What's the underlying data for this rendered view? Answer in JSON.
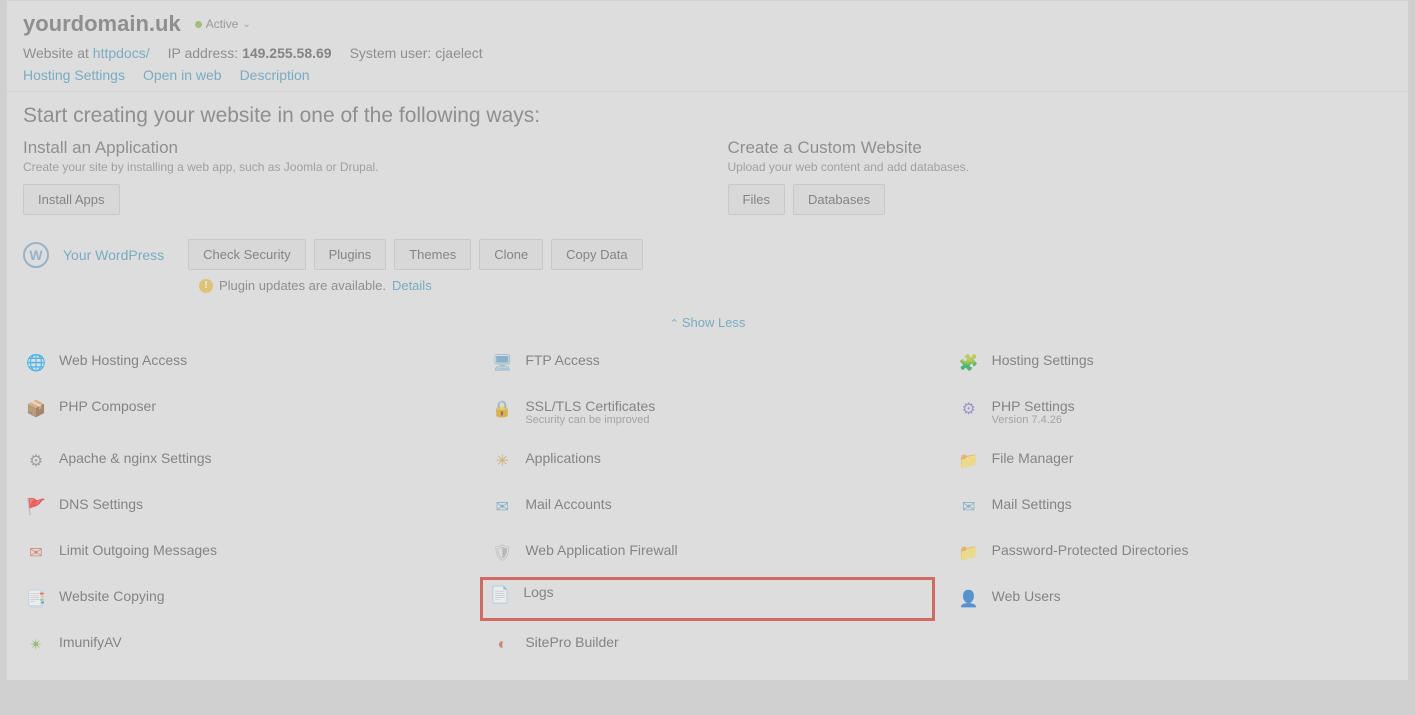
{
  "header": {
    "domain": "yourdomain.uk",
    "status": "Active",
    "website_at_label": "Website at",
    "website_at_link": "httpdocs/",
    "ip_label": "IP address:",
    "ip_value": "149.255.58.69",
    "sysuser_label": "System user:",
    "sysuser_value": "cjaelect",
    "links": {
      "hosting_settings": "Hosting Settings",
      "open_in_web": "Open in web",
      "description": "Description"
    }
  },
  "create": {
    "title": "Start creating your website in one of the following ways:",
    "install": {
      "heading": "Install an Application",
      "desc": "Create your site by installing a web app, such as Joomla or Drupal.",
      "btn": "Install Apps"
    },
    "custom": {
      "heading": "Create a Custom Website",
      "desc": "Upload your web content and add databases.",
      "btn_files": "Files",
      "btn_db": "Databases"
    }
  },
  "wp": {
    "label": "Your WordPress",
    "buttons": {
      "check_security": "Check Security",
      "plugins": "Plugins",
      "themes": "Themes",
      "clone": "Clone",
      "copy_data": "Copy Data"
    },
    "warning": "Plugin updates are available.",
    "details": "Details"
  },
  "showless": "Show Less",
  "tools": {
    "col1": [
      {
        "label": "Web Hosting Access"
      },
      {
        "label": "PHP Composer"
      },
      {
        "label": "Apache & nginx Settings"
      },
      {
        "label": "DNS Settings"
      },
      {
        "label": "Limit Outgoing Messages"
      },
      {
        "label": "Website Copying"
      },
      {
        "label": "ImunifyAV"
      }
    ],
    "col2": [
      {
        "label": "FTP Access"
      },
      {
        "label": "SSL/TLS Certificates",
        "sub": "Security can be improved"
      },
      {
        "label": "Applications"
      },
      {
        "label": "Mail Accounts"
      },
      {
        "label": "Web Application Firewall"
      },
      {
        "label": "Logs"
      },
      {
        "label": "SitePro Builder"
      }
    ],
    "col3": [
      {
        "label": "Hosting Settings"
      },
      {
        "label": "PHP Settings",
        "sub": "Version 7.4.26"
      },
      {
        "label": "File Manager"
      },
      {
        "label": "Mail Settings"
      },
      {
        "label": "Password-Protected Directories"
      },
      {
        "label": "Web Users"
      }
    ]
  }
}
